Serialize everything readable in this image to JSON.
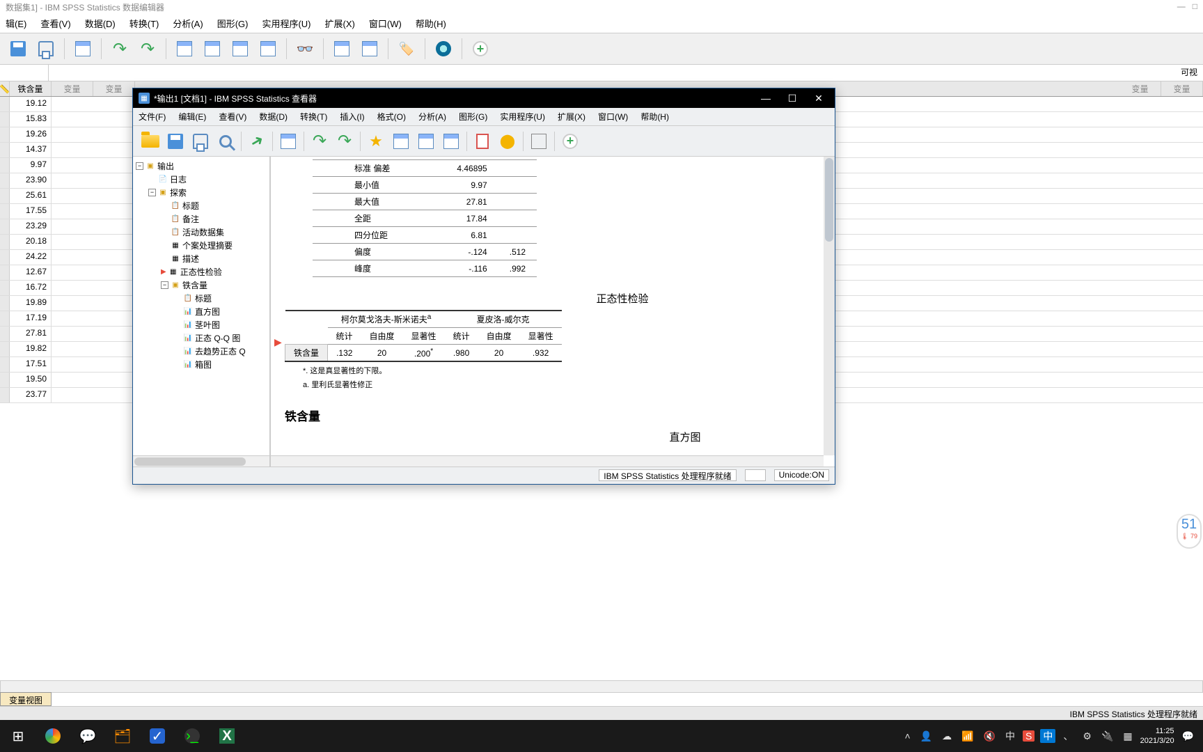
{
  "main_window": {
    "title": "数据集1] - IBM SPSS Statistics 数据编辑器",
    "right_label": "可视"
  },
  "main_menu": {
    "edit": "辑(E)",
    "view": "查看(V)",
    "data": "数据(D)",
    "transform": "转换(T)",
    "analyze": "分析(A)",
    "graphs": "图形(G)",
    "utilities": "实用程序(U)",
    "extensions": "扩展(X)",
    "window": "窗口(W)",
    "help": "帮助(H)"
  },
  "data_editor": {
    "col_header": "铁含量",
    "empty_col": "变量",
    "values": [
      "19.12",
      "15.83",
      "19.26",
      "14.37",
      "9.97",
      "23.90",
      "25.61",
      "17.55",
      "23.29",
      "20.18",
      "24.22",
      "12.67",
      "16.72",
      "19.89",
      "17.19",
      "27.81",
      "19.82",
      "17.51",
      "19.50",
      "23.77"
    ],
    "bottom_tab": "变量视图"
  },
  "viewer": {
    "title": "*输出1 [文档1] - IBM SPSS Statistics 查看器",
    "menu": {
      "file": "文件(F)",
      "edit": "编辑(E)",
      "view": "查看(V)",
      "data": "数据(D)",
      "transform": "转换(T)",
      "insert": "插入(I)",
      "format": "格式(O)",
      "analyze": "分析(A)",
      "graphs": "图形(G)",
      "utilities": "实用程序(U)",
      "extensions": "扩展(X)",
      "window": "窗口(W)",
      "help": "帮助(H)"
    },
    "tree": {
      "root": "输出",
      "log": "日志",
      "explore": "探索",
      "title": "标题",
      "notes": "备注",
      "active_dataset": "活动数据集",
      "case_summary": "个案处理摘要",
      "descriptives": "描述",
      "normality": "正态性检验",
      "var": "铁含量",
      "subtitle": "标题",
      "histogram": "直方图",
      "stemleaf": "茎叶图",
      "qq": "正态 Q-Q 图",
      "detrended_qq": "去趋势正态 Q",
      "boxplot": "箱图"
    },
    "stats": {
      "stddev_label": "标准 偏差",
      "stddev": "4.46895",
      "min_label": "最小值",
      "min": "9.97",
      "max_label": "最大值",
      "max": "27.81",
      "range_label": "全距",
      "range": "17.84",
      "iqr_label": "四分位距",
      "iqr": "6.81",
      "skew_label": "偏度",
      "skew": "-.124",
      "skew_se": ".512",
      "kurt_label": "峰度",
      "kurt": "-.116",
      "kurt_se": ".992"
    },
    "normality": {
      "title": "正态性检验",
      "ks_header": "柯尔莫戈洛夫-斯米诺夫",
      "sw_header": "夏皮洛-威尔克",
      "stat": "统计",
      "df": "自由度",
      "sig": "显著性",
      "rowlabel": "铁含量",
      "ks_stat": ".132",
      "ks_df": "20",
      "ks_sig": ".200",
      "sw_stat": ".980",
      "sw_df": "20",
      "sw_sig": ".932",
      "note1": "*. 这是真显著性的下限。",
      "note2": "a. 里利氏显著性修正"
    },
    "section_heading": "铁含量",
    "next_title": "直方图",
    "status": {
      "processor": "IBM SPSS Statistics 处理程序就绪",
      "unicode": "Unicode:ON"
    }
  },
  "main_status": {
    "processor": "IBM SPSS Statistics 处理程序就绪"
  },
  "systray": {
    "ime": "中",
    "sogou": "S"
  },
  "temp_widget": {
    "big": "51",
    "small": "79"
  },
  "clock": {
    "time": "11:25",
    "date": "2021/3/20"
  }
}
